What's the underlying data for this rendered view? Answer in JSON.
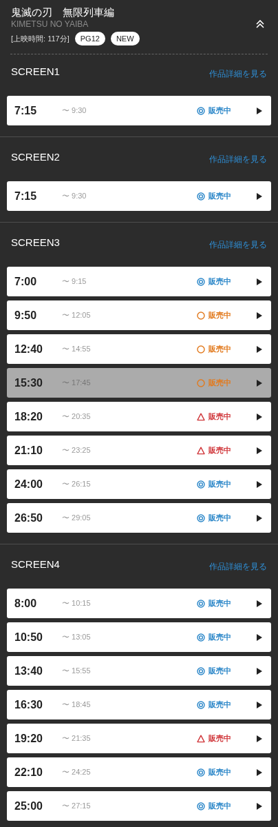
{
  "movie": {
    "title": "鬼滅の刃　無限列車編",
    "subtitle": "KIMETSU NO YAIBA",
    "runtime": "[上映時間: 117分]",
    "badges": [
      "PG12",
      "NEW"
    ],
    "expanded": true
  },
  "screens": [
    {
      "name": "SCREEN1",
      "detail_link": "作品詳細を見る",
      "showings": [
        {
          "start": "7:15",
          "end": "〜 9:30",
          "kind": "double-circle",
          "status": "販売中",
          "disabled": false
        }
      ]
    },
    {
      "name": "SCREEN2",
      "detail_link": "作品詳細を見る",
      "showings": [
        {
          "start": "7:15",
          "end": "〜 9:30",
          "kind": "double-circle",
          "status": "販売中",
          "disabled": false
        }
      ]
    },
    {
      "name": "SCREEN3",
      "detail_link": "作品詳細を見る",
      "showings": [
        {
          "start": "7:00",
          "end": "〜 9:15",
          "kind": "double-circle",
          "status": "販売中",
          "disabled": false
        },
        {
          "start": "9:50",
          "end": "〜 12:05",
          "kind": "circle",
          "status": "販売中",
          "disabled": false
        },
        {
          "start": "12:40",
          "end": "〜 14:55",
          "kind": "circle",
          "status": "販売中",
          "disabled": false
        },
        {
          "start": "15:30",
          "end": "〜 17:45",
          "kind": "circle",
          "status": "販売中",
          "disabled": true
        },
        {
          "start": "18:20",
          "end": "〜 20:35",
          "kind": "triangle",
          "status": "販売中",
          "disabled": false
        },
        {
          "start": "21:10",
          "end": "〜 23:25",
          "kind": "triangle",
          "status": "販売中",
          "disabled": false
        },
        {
          "start": "24:00",
          "end": "〜 26:15",
          "kind": "double-circle",
          "status": "販売中",
          "disabled": false
        },
        {
          "start": "26:50",
          "end": "〜 29:05",
          "kind": "double-circle",
          "status": "販売中",
          "disabled": false
        }
      ]
    },
    {
      "name": "SCREEN4",
      "detail_link": "作品詳細を見る",
      "showings": [
        {
          "start": "8:00",
          "end": "〜 10:15",
          "kind": "double-circle",
          "status": "販売中",
          "disabled": false
        },
        {
          "start": "10:50",
          "end": "〜 13:05",
          "kind": "double-circle",
          "status": "販売中",
          "disabled": false
        },
        {
          "start": "13:40",
          "end": "〜 15:55",
          "kind": "double-circle",
          "status": "販売中",
          "disabled": false
        },
        {
          "start": "16:30",
          "end": "〜 18:45",
          "kind": "double-circle",
          "status": "販売中",
          "disabled": false
        },
        {
          "start": "19:20",
          "end": "〜 21:35",
          "kind": "triangle",
          "status": "販売中",
          "disabled": false
        },
        {
          "start": "22:10",
          "end": "〜 24:25",
          "kind": "double-circle",
          "status": "販売中",
          "disabled": false
        },
        {
          "start": "25:00",
          "end": "〜 27:15",
          "kind": "double-circle",
          "status": "販売中",
          "disabled": false
        }
      ]
    }
  ]
}
